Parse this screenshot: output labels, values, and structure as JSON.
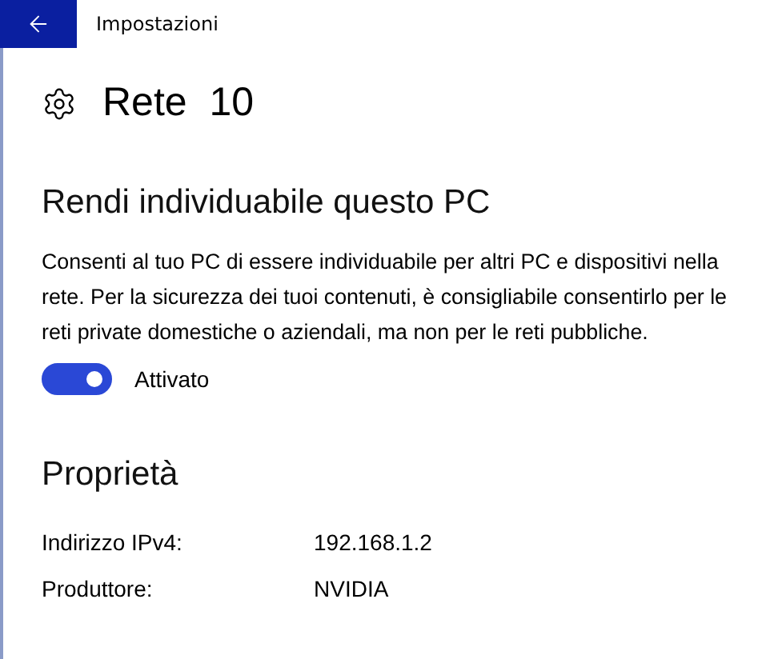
{
  "window": {
    "title": "Impostazioni"
  },
  "page": {
    "title": "Rete  10"
  },
  "discovery": {
    "heading": "Rendi individuabile questo PC",
    "description": "Consenti al tuo PC di essere individuabile per altri PC e dispositivi nella rete. Per la sicurezza dei tuoi contenuti, è consigliabile consentirlo per le reti private domestiche o aziendali, ma non per le reti pubbliche.",
    "toggle": {
      "on": true,
      "label": "Attivato"
    }
  },
  "properties": {
    "heading": "Proprietà",
    "rows": [
      {
        "label": "Indirizzo IPv4:",
        "value": "192.168.1.2"
      },
      {
        "label": "Produttore:",
        "value": "NVIDIA"
      }
    ]
  }
}
